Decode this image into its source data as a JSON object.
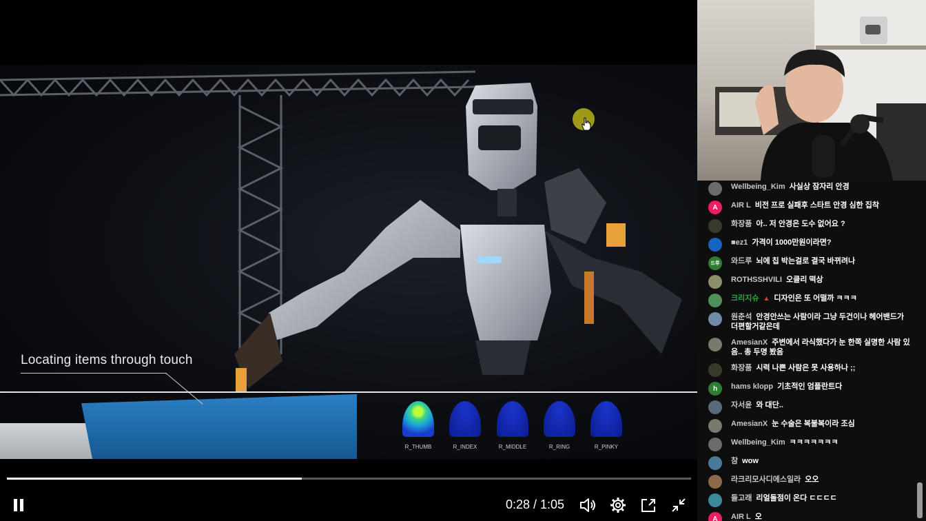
{
  "video": {
    "annotation": "Locating items through touch",
    "finger_sensors": [
      {
        "label": "R_THUMB",
        "active": true
      },
      {
        "label": "R_INDEX",
        "active": false
      },
      {
        "label": "R_MIDDLE",
        "active": false
      },
      {
        "label": "R_RING",
        "active": false
      },
      {
        "label": "R_PINKY",
        "active": false
      }
    ]
  },
  "controls": {
    "time_display": "0:28 / 1:05",
    "progress_fraction": 0.4308,
    "icons": [
      "pause-icon",
      "volume-icon",
      "settings-gear-icon",
      "miniplayer-icon",
      "exit-fullscreen-icon"
    ]
  },
  "colors": {
    "cursor_highlight": "#b9b21a",
    "hud_active_sensor": "#b8ff3a",
    "hud_sensor": "#1a35c9",
    "chat_background": "#0e0e0e",
    "highlighted_author": "#2ba640"
  },
  "chat": {
    "messages": [
      {
        "author": "Wellbeing_Kim",
        "text": "사실상 잠자리 안경",
        "avatar": "",
        "avatar_color": "#6b6b6b"
      },
      {
        "author": "AIR L",
        "text": "비전 프로 실패후 스타트 안경 심한 집착",
        "avatar": "A",
        "avatar_color": "#e91e63"
      },
      {
        "author": "화장품",
        "text": "아.. 저 안경은 도수 없어요 ?",
        "avatar": "",
        "avatar_color": "#3a3a2a"
      },
      {
        "author": "■ez1",
        "text": "가격이 1000만원이라면?",
        "avatar": "",
        "avatar_color": "#1565c0"
      },
      {
        "author": "와드루",
        "text": "뇌에 칩 박는걸로 결국 바뀌려나",
        "avatar": "드루",
        "avatar_color": "#2e7d32"
      },
      {
        "author": "ROTHSSHVILI",
        "text": "오클리 떡상",
        "avatar": "",
        "avatar_color": "#8d8d6a"
      },
      {
        "author": "크리지슈",
        "text": "디자인은 또 어떨까 ㅋㅋㅋ",
        "avatar": "",
        "avatar_color": "#4f8f5a",
        "highlight": true
      },
      {
        "author": "원춘석",
        "text": "안경안쓰는 사람이라 그냥 두건이나 헤어밴드가 더편할거같은데",
        "avatar": "",
        "avatar_color": "#6f8ba8"
      },
      {
        "author": "AmesianX",
        "text": "주변에서 라식했다가 눈 한쪽 실명한 사람 있음.. 총 두명 봤음",
        "avatar": "",
        "avatar_color": "#7a7a6a"
      },
      {
        "author": "화장품",
        "text": "시력 나쁜 사람은 못 사용하나 ;;",
        "avatar": "",
        "avatar_color": "#3a3a2a"
      },
      {
        "author": "hams klopp",
        "text": "기초적인 엄플란트다",
        "avatar": "h",
        "avatar_color": "#2e7d32"
      },
      {
        "author": "자서윤",
        "text": "와 대단..",
        "avatar": "",
        "avatar_color": "#5a6a7a"
      },
      {
        "author": "AmesianX",
        "text": "눈 수술은 복불복이라 조심",
        "avatar": "",
        "avatar_color": "#7a7a6a"
      },
      {
        "author": "Wellbeing_Kim",
        "text": "ㅋㅋㅋㅋㅋㅋㅋ",
        "avatar": "",
        "avatar_color": "#6b6b6b"
      },
      {
        "author": "참",
        "text": "wow",
        "avatar": "",
        "avatar_color": "#4a7a9a"
      },
      {
        "author": "라크리모사디에스일라",
        "text": "오오",
        "avatar": "",
        "avatar_color": "#8a6a4a"
      },
      {
        "author": "들고래",
        "text": "리얼돌점이 온다 ㄷㄷㄷㄷ",
        "avatar": "",
        "avatar_color": "#3a8a9a"
      },
      {
        "author": "AIR L",
        "text": "오",
        "avatar": "A",
        "avatar_color": "#e91e63"
      }
    ]
  }
}
